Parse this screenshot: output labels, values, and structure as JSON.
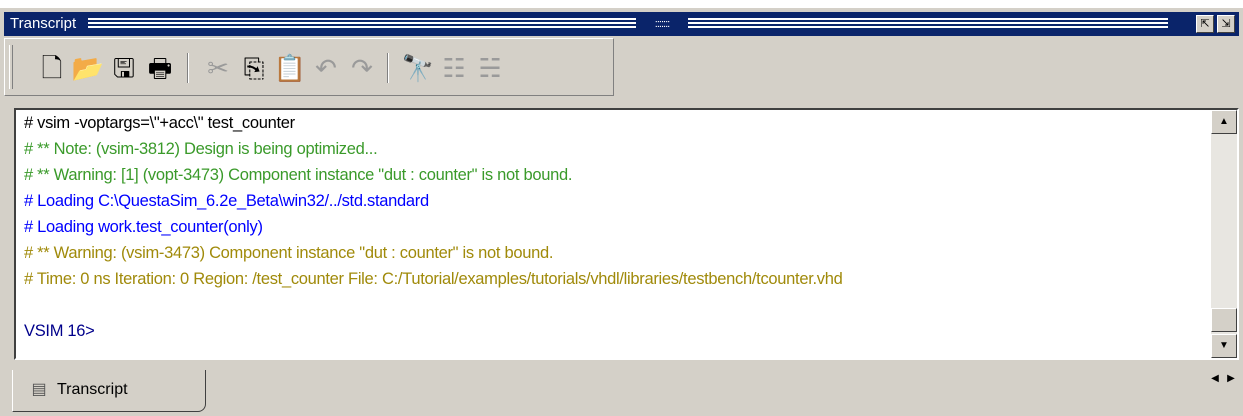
{
  "window": {
    "title": "Transcript",
    "title_dots": ":::::::",
    "buttons": [
      {
        "name": "float-window-button",
        "glyph": "⇱"
      },
      {
        "name": "undock-window-button",
        "glyph": "⇲"
      }
    ]
  },
  "toolbar": {
    "buttons": [
      {
        "name": "new-file-button",
        "icon": "new-document-icon",
        "glyph": "🗋",
        "enabled": true
      },
      {
        "name": "open-file-button",
        "icon": "folder-open-icon",
        "glyph": "📂",
        "enabled": true
      },
      {
        "name": "save-button",
        "icon": "floppy-disk-icon",
        "glyph": "🖫",
        "enabled": true
      },
      {
        "name": "print-button",
        "icon": "printer-icon",
        "glyph": "🖶",
        "enabled": true
      },
      {
        "name": "cut-button",
        "icon": "scissors-icon",
        "glyph": "✂",
        "enabled": false
      },
      {
        "name": "copy-button",
        "icon": "copy-icon",
        "glyph": "⎘",
        "enabled": true
      },
      {
        "name": "paste-button",
        "icon": "paste-icon",
        "glyph": "📋",
        "enabled": true
      },
      {
        "name": "undo-button",
        "icon": "undo-icon",
        "glyph": "↶",
        "enabled": false
      },
      {
        "name": "redo-button",
        "icon": "redo-icon",
        "glyph": "↷",
        "enabled": false
      },
      {
        "name": "find-button",
        "icon": "binoculars-icon",
        "glyph": "🔭",
        "enabled": true
      },
      {
        "name": "collapse-tree-button",
        "icon": "tree-collapse-icon",
        "glyph": "☷",
        "enabled": false
      },
      {
        "name": "expand-tree-button",
        "icon": "tree-expand-icon",
        "glyph": "☵",
        "enabled": false
      }
    ]
  },
  "colors": {
    "command": "#000000",
    "note": "#3a9a2a",
    "warning": "#a08a0a",
    "loading": "#0000ff",
    "prompt": "#00008b"
  },
  "transcript": {
    "lines": [
      {
        "text": "# vsim -voptargs=\\\"+acc\\\" test_counter",
        "kind": "command"
      },
      {
        "text": "# ** Note: (vsim-3812) Design is being optimized...",
        "kind": "note"
      },
      {
        "text": "# ** Warning: [1] (vopt-3473) Component instance \"dut : counter\" is not bound.",
        "kind": "note"
      },
      {
        "text": "# Loading C:\\QuestaSim_6.2e_Beta\\win32/../std.standard",
        "kind": "loading"
      },
      {
        "text": "# Loading work.test_counter(only)",
        "kind": "loading"
      },
      {
        "text": "# ** Warning: (vsim-3473) Component instance \"dut : counter\" is not bound.",
        "kind": "warning"
      },
      {
        "text": "#    Time: 0 ns  Iteration: 0  Region: /test_counter  File: C:/Tutorial/examples/tutorials/vhdl/libraries/testbench/tcounter.vhd",
        "kind": "warning"
      }
    ],
    "prompt": "VSIM 16>"
  },
  "tabs": [
    {
      "label": "Transcript",
      "icon": "transcript-icon",
      "glyph": "▤"
    }
  ],
  "scroll": {
    "up_glyph": "▲",
    "down_glyph": "▼",
    "left_glyph": "◀",
    "right_glyph": "▶"
  }
}
